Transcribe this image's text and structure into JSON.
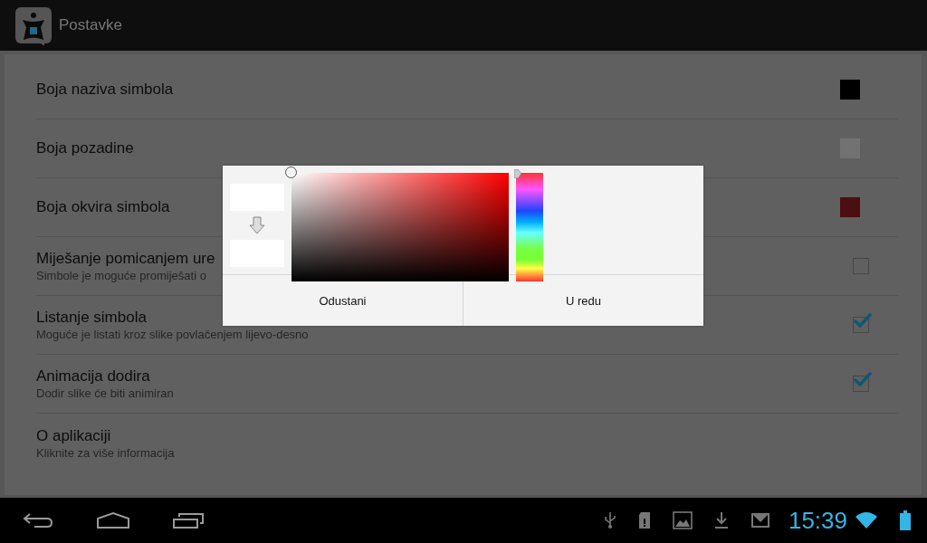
{
  "action_bar": {
    "title": "Postavke"
  },
  "settings": [
    {
      "kind": "color",
      "title": "Boja naziva simbola",
      "color": "#000000"
    },
    {
      "kind": "color",
      "title": "Boja pozadine",
      "color": "#727272"
    },
    {
      "kind": "color",
      "title": "Boja okvira simbola",
      "color": "#4b0e11"
    },
    {
      "kind": "checkbox",
      "title": "Miješanje pomicanjem ure",
      "summary": "Simbole je moguće promiješati o",
      "checked": false
    },
    {
      "kind": "checkbox",
      "title": "Listanje simbola",
      "summary": "Moguće je listati kroz slike povlačenjem lijevo-desno",
      "checked": true
    },
    {
      "kind": "checkbox",
      "title": "Animacija dodira",
      "summary": "Dodir slike će biti animiran",
      "checked": true
    },
    {
      "kind": "plain",
      "title": "O aplikaciji",
      "summary": "Kliknite za više informacija"
    }
  ],
  "dialog": {
    "buttons": [
      "Odustani",
      "U redu"
    ]
  },
  "system_bar": {
    "time": "15:39"
  }
}
